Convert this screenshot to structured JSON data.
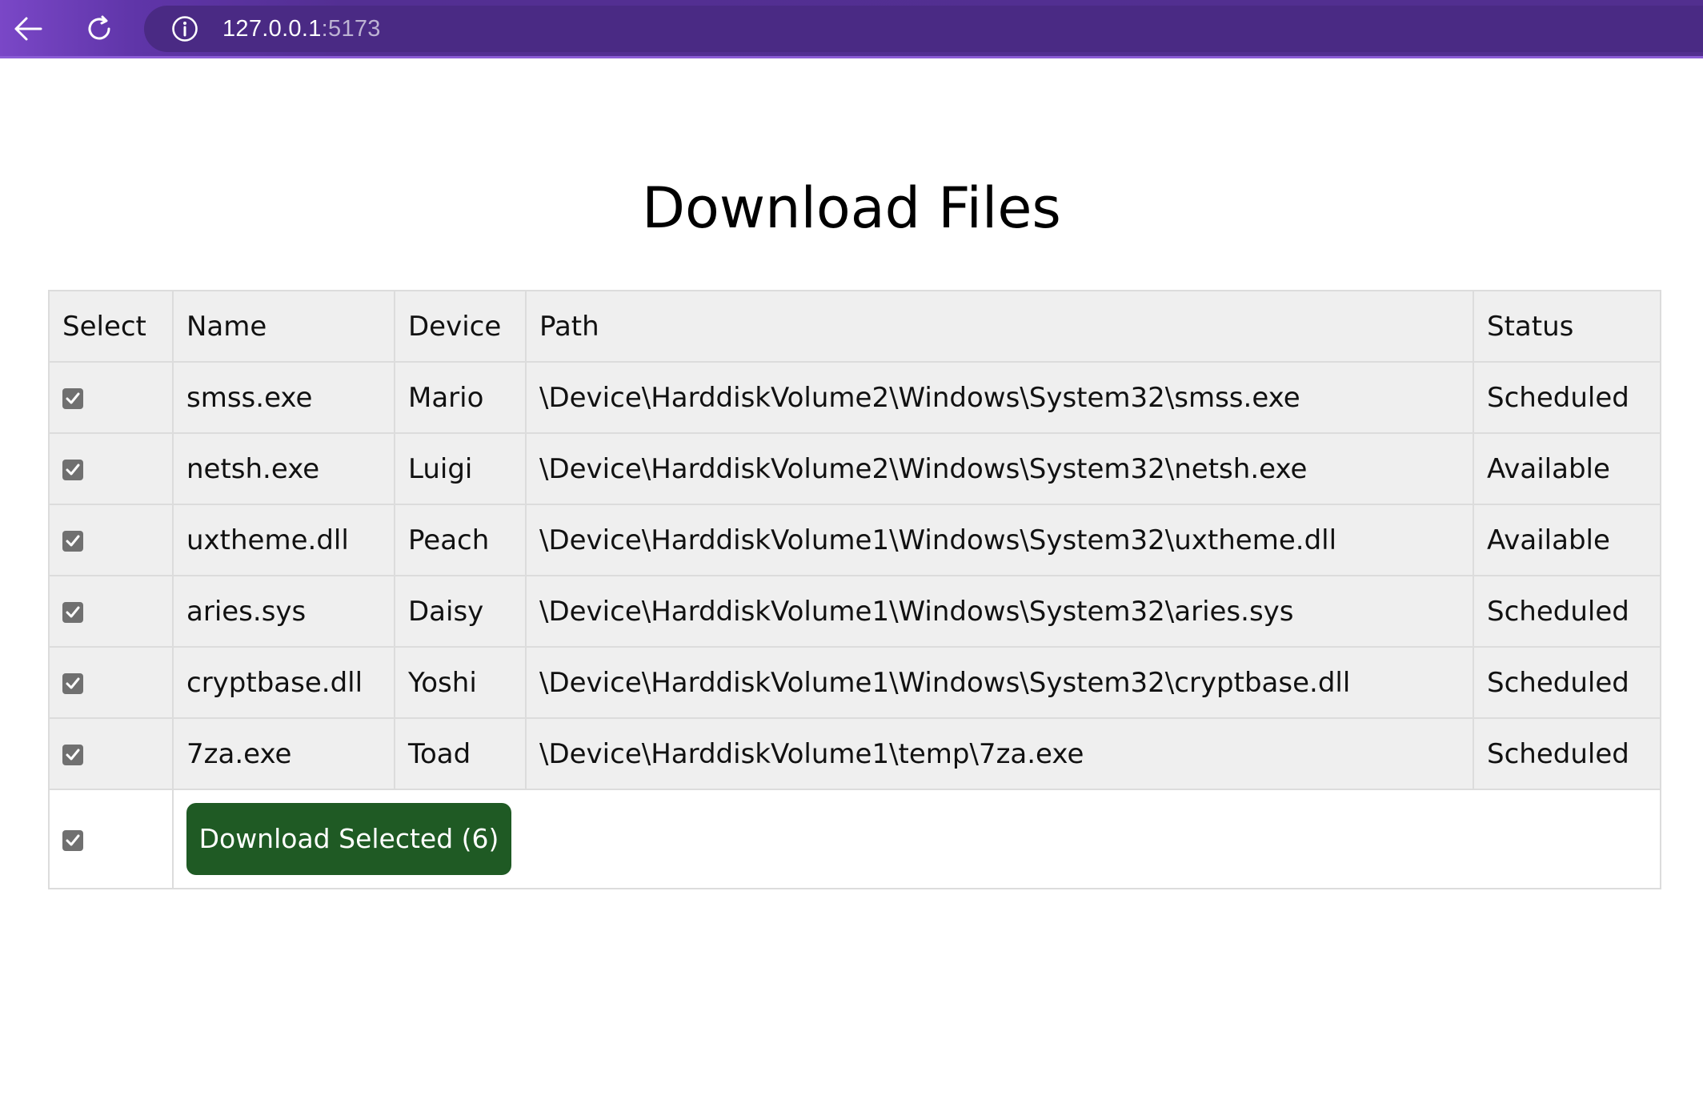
{
  "browser": {
    "url_host": "127.0.0.1",
    "url_port": ":5173"
  },
  "page": {
    "title": "Download Files"
  },
  "table": {
    "headers": {
      "select": "Select",
      "name": "Name",
      "device": "Device",
      "path": "Path",
      "status": "Status"
    },
    "rows": [
      {
        "checked": true,
        "name": "smss.exe",
        "device": "Mario",
        "path": "\\Device\\HarddiskVolume2\\Windows\\System32\\smss.exe",
        "status": "Scheduled"
      },
      {
        "checked": true,
        "name": "netsh.exe",
        "device": "Luigi",
        "path": "\\Device\\HarddiskVolume2\\Windows\\System32\\netsh.exe",
        "status": "Available"
      },
      {
        "checked": true,
        "name": "uxtheme.dll",
        "device": "Peach",
        "path": "\\Device\\HarddiskVolume1\\Windows\\System32\\uxtheme.dll",
        "status": "Available"
      },
      {
        "checked": true,
        "name": "aries.sys",
        "device": "Daisy",
        "path": "\\Device\\HarddiskVolume1\\Windows\\System32\\aries.sys",
        "status": "Scheduled"
      },
      {
        "checked": true,
        "name": "cryptbase.dll",
        "device": "Yoshi",
        "path": "\\Device\\HarddiskVolume1\\Windows\\System32\\cryptbase.dll",
        "status": "Scheduled"
      },
      {
        "checked": true,
        "name": "7za.exe",
        "device": "Toad",
        "path": "\\Device\\HarddiskVolume1\\temp\\7za.exe",
        "status": "Scheduled"
      }
    ],
    "select_all_checked": true,
    "download_button_label": "Download Selected (6)"
  },
  "colors": {
    "chrome": "#532f93",
    "button": "#1f5a24",
    "row_bg": "#efefef"
  }
}
